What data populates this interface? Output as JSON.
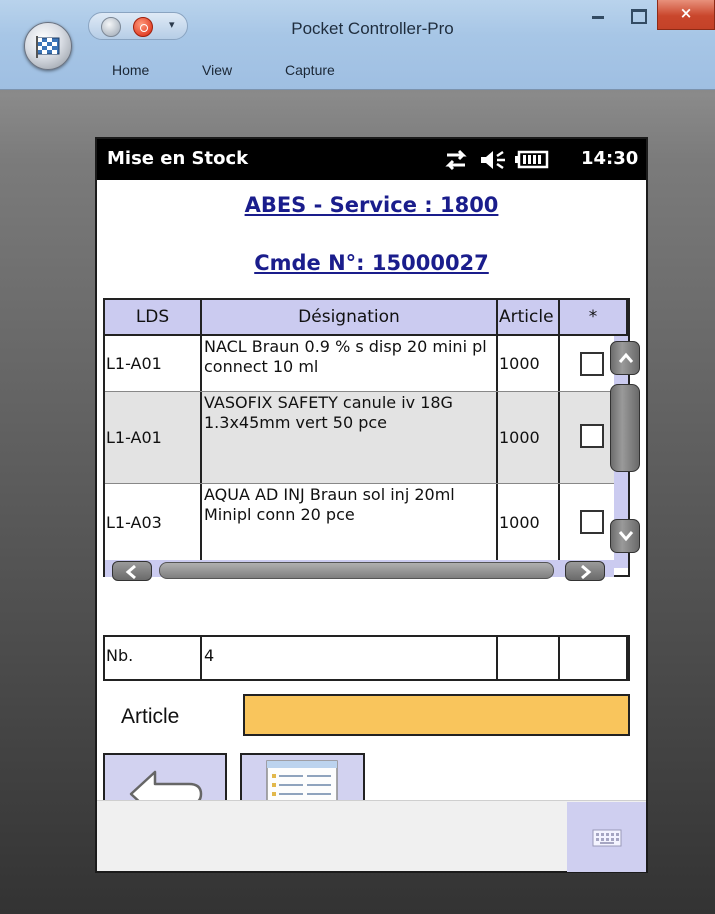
{
  "window": {
    "title": "Pocket Controller-Pro",
    "menu": [
      "Home",
      "View",
      "Capture"
    ],
    "close_glyph": "×"
  },
  "status_bar": {
    "title": "Mise en Stock",
    "time": "14:30",
    "icons": [
      "sync-arrows-icon",
      "speaker-icon",
      "battery-icon"
    ]
  },
  "header": {
    "service": "ABES - Service : 1800",
    "order": "Cmde N°: 15000027"
  },
  "grid": {
    "columns": [
      "LDS",
      "Désignation",
      "Article",
      "*"
    ],
    "rows": [
      {
        "lds": "L1-A01",
        "designation": "NACL Braun 0.9 % s disp 20 mini pl connect 10 ml",
        "article": "1000",
        "checked": false
      },
      {
        "lds": "L1-A01",
        "designation": "VASOFIX SAFETY canule iv 18G 1.3x45mm vert 50 pce",
        "article": "1000",
        "checked": false
      },
      {
        "lds": "L1-A03",
        "designation": "AQUA AD INJ Braun sol inj 20ml Minipl conn 20 pce",
        "article": "1000",
        "checked": false
      }
    ]
  },
  "footer_row": {
    "label": "Nb.",
    "value": "4"
  },
  "article_field": {
    "label": "Article",
    "value": ""
  },
  "colors": {
    "header_bg": "#cbcbf0",
    "link": "#1a1d8c",
    "input_bg": "#f9c55c",
    "button_bg": "#d2d2f0"
  }
}
